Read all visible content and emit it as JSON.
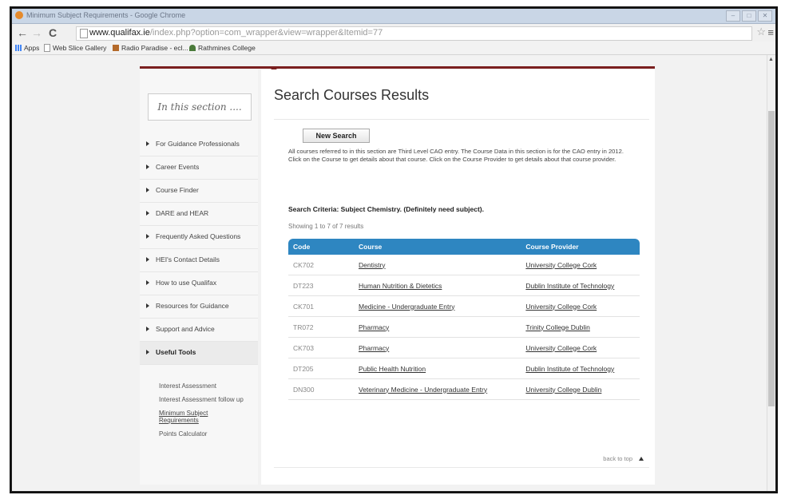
{
  "window": {
    "tab_title": "Minimum Subject Requirements - Google Chrome"
  },
  "browser": {
    "url_main": "www.qualifax.ie",
    "url_rest": "/index.php?option=com_wrapper&view=wrapper&Itemid=77",
    "back": "←",
    "forward": "→",
    "reload": "C",
    "star": "☆",
    "menu": "≡"
  },
  "bookmarks": [
    {
      "label": "Apps"
    },
    {
      "label": "Web Slice Gallery"
    },
    {
      "label": "Radio Paradise - ecl..."
    },
    {
      "label": "Rathmines College"
    }
  ],
  "sidebar": {
    "section_title": "In this section ....",
    "items": [
      {
        "label": "For Guidance Professionals"
      },
      {
        "label": "Career Events"
      },
      {
        "label": "Course Finder"
      },
      {
        "label": "DARE and HEAR"
      },
      {
        "label": "Frequently Asked Questions"
      },
      {
        "label": "HEI's Contact Details"
      },
      {
        "label": "How to use Qualifax"
      },
      {
        "label": "Resources for Guidance"
      },
      {
        "label": "Support and Advice"
      },
      {
        "label": "Useful Tools"
      }
    ],
    "sub_items": [
      {
        "label": "Interest Assessment"
      },
      {
        "label": "Interest Assessment follow up"
      },
      {
        "label": "Minimum Subject Requirements"
      },
      {
        "label": "Points Calculator"
      }
    ]
  },
  "main": {
    "title": "Search Courses Results",
    "new_search": "New Search",
    "intro_1": "All courses referred to in this section are Third Level CAO entry. The Course Data in this section is for the CAO entry in 2012.",
    "intro_2": "Click on the Course to get details about that course. Click on the Course Provider to get details about that course provider.",
    "criteria": "Search Criteria: Subject Chemistry. (Definitely need subject).",
    "showing": "Showing 1 to 7 of 7 results",
    "table": {
      "headers": [
        "Code",
        "Course",
        "Course Provider"
      ],
      "rows": [
        {
          "code": "CK702",
          "course": "Dentistry",
          "provider": "University College Cork"
        },
        {
          "code": "DT223",
          "course": "Human Nutrition & Dietetics",
          "provider": "Dublin Institute of Technology"
        },
        {
          "code": "CK701",
          "course": "Medicine - Undergraduate Entry",
          "provider": "University College Cork"
        },
        {
          "code": "TR072",
          "course": "Pharmacy",
          "provider": "Trinity College Dublin"
        },
        {
          "code": "CK703",
          "course": "Pharmacy",
          "provider": "University College Cork"
        },
        {
          "code": "DT205",
          "course": "Public Health Nutrition",
          "provider": "Dublin Institute of Technology"
        },
        {
          "code": "DN300",
          "course": "Veterinary Medicine - Undergraduate Entry",
          "provider": "University College Dublin"
        }
      ]
    },
    "back_to_top": "back to top"
  }
}
